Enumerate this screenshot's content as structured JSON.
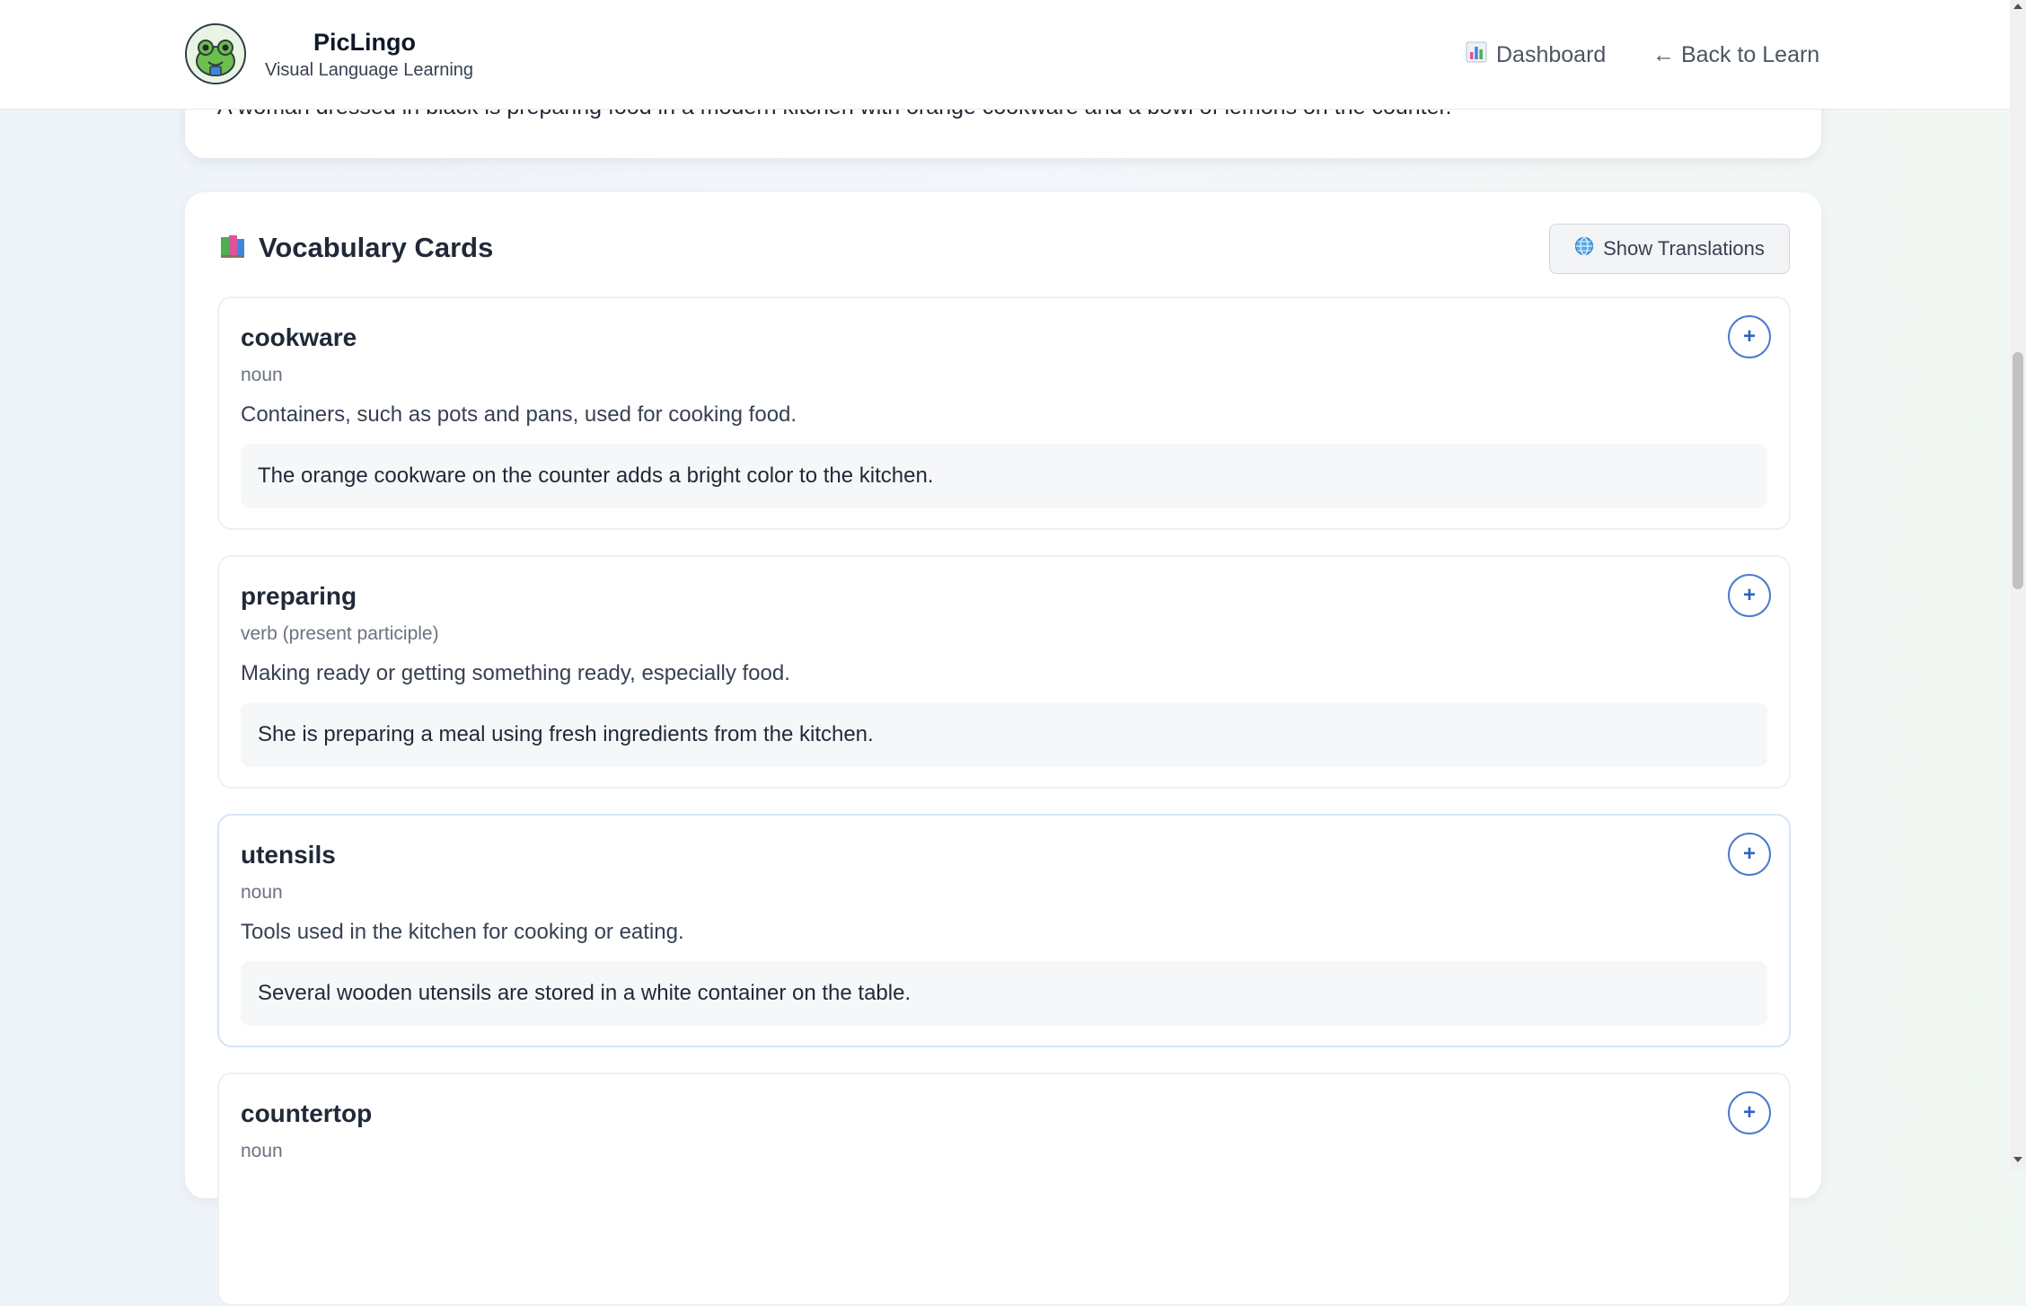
{
  "header": {
    "brand_title": "PicLingo",
    "brand_subtitle": "Visual Language Learning",
    "logo_icon": "frog-mascot-icon",
    "nav": {
      "dashboard_label": "Dashboard",
      "dashboard_icon": "bar-chart-icon",
      "back_label": "← Back to Learn"
    }
  },
  "description": {
    "text": "A woman dressed in black is preparing food in a modern kitchen with orange cookware and a bowl of lemons on the counter.",
    "add_symbol": "+"
  },
  "vocab": {
    "heading": "Vocabulary Cards",
    "heading_icon": "books-icon",
    "show_translations_label": "Show Translations",
    "show_translations_icon": "globe-icon",
    "add_symbol": "+",
    "cards": [
      {
        "word": "cookware",
        "pos": "noun",
        "definition": "Containers, such as pots and pans, used for cooking food.",
        "example": "The orange cookware on the counter adds a bright color to the kitchen."
      },
      {
        "word": "preparing",
        "pos": "verb (present participle)",
        "definition": "Making ready or getting something ready, especially food.",
        "example": "She is preparing a meal using fresh ingredients from the kitchen."
      },
      {
        "word": "utensils",
        "pos": "noun",
        "definition": "Tools used in the kitchen for cooking or eating.",
        "example": "Several wooden utensils are stored in a white container on the table."
      },
      {
        "word": "countertop",
        "pos": "noun",
        "definition": "",
        "example": ""
      }
    ]
  },
  "colors": {
    "accent_blue": "#2f63c4",
    "accent_orange": "#ea6a1f"
  }
}
